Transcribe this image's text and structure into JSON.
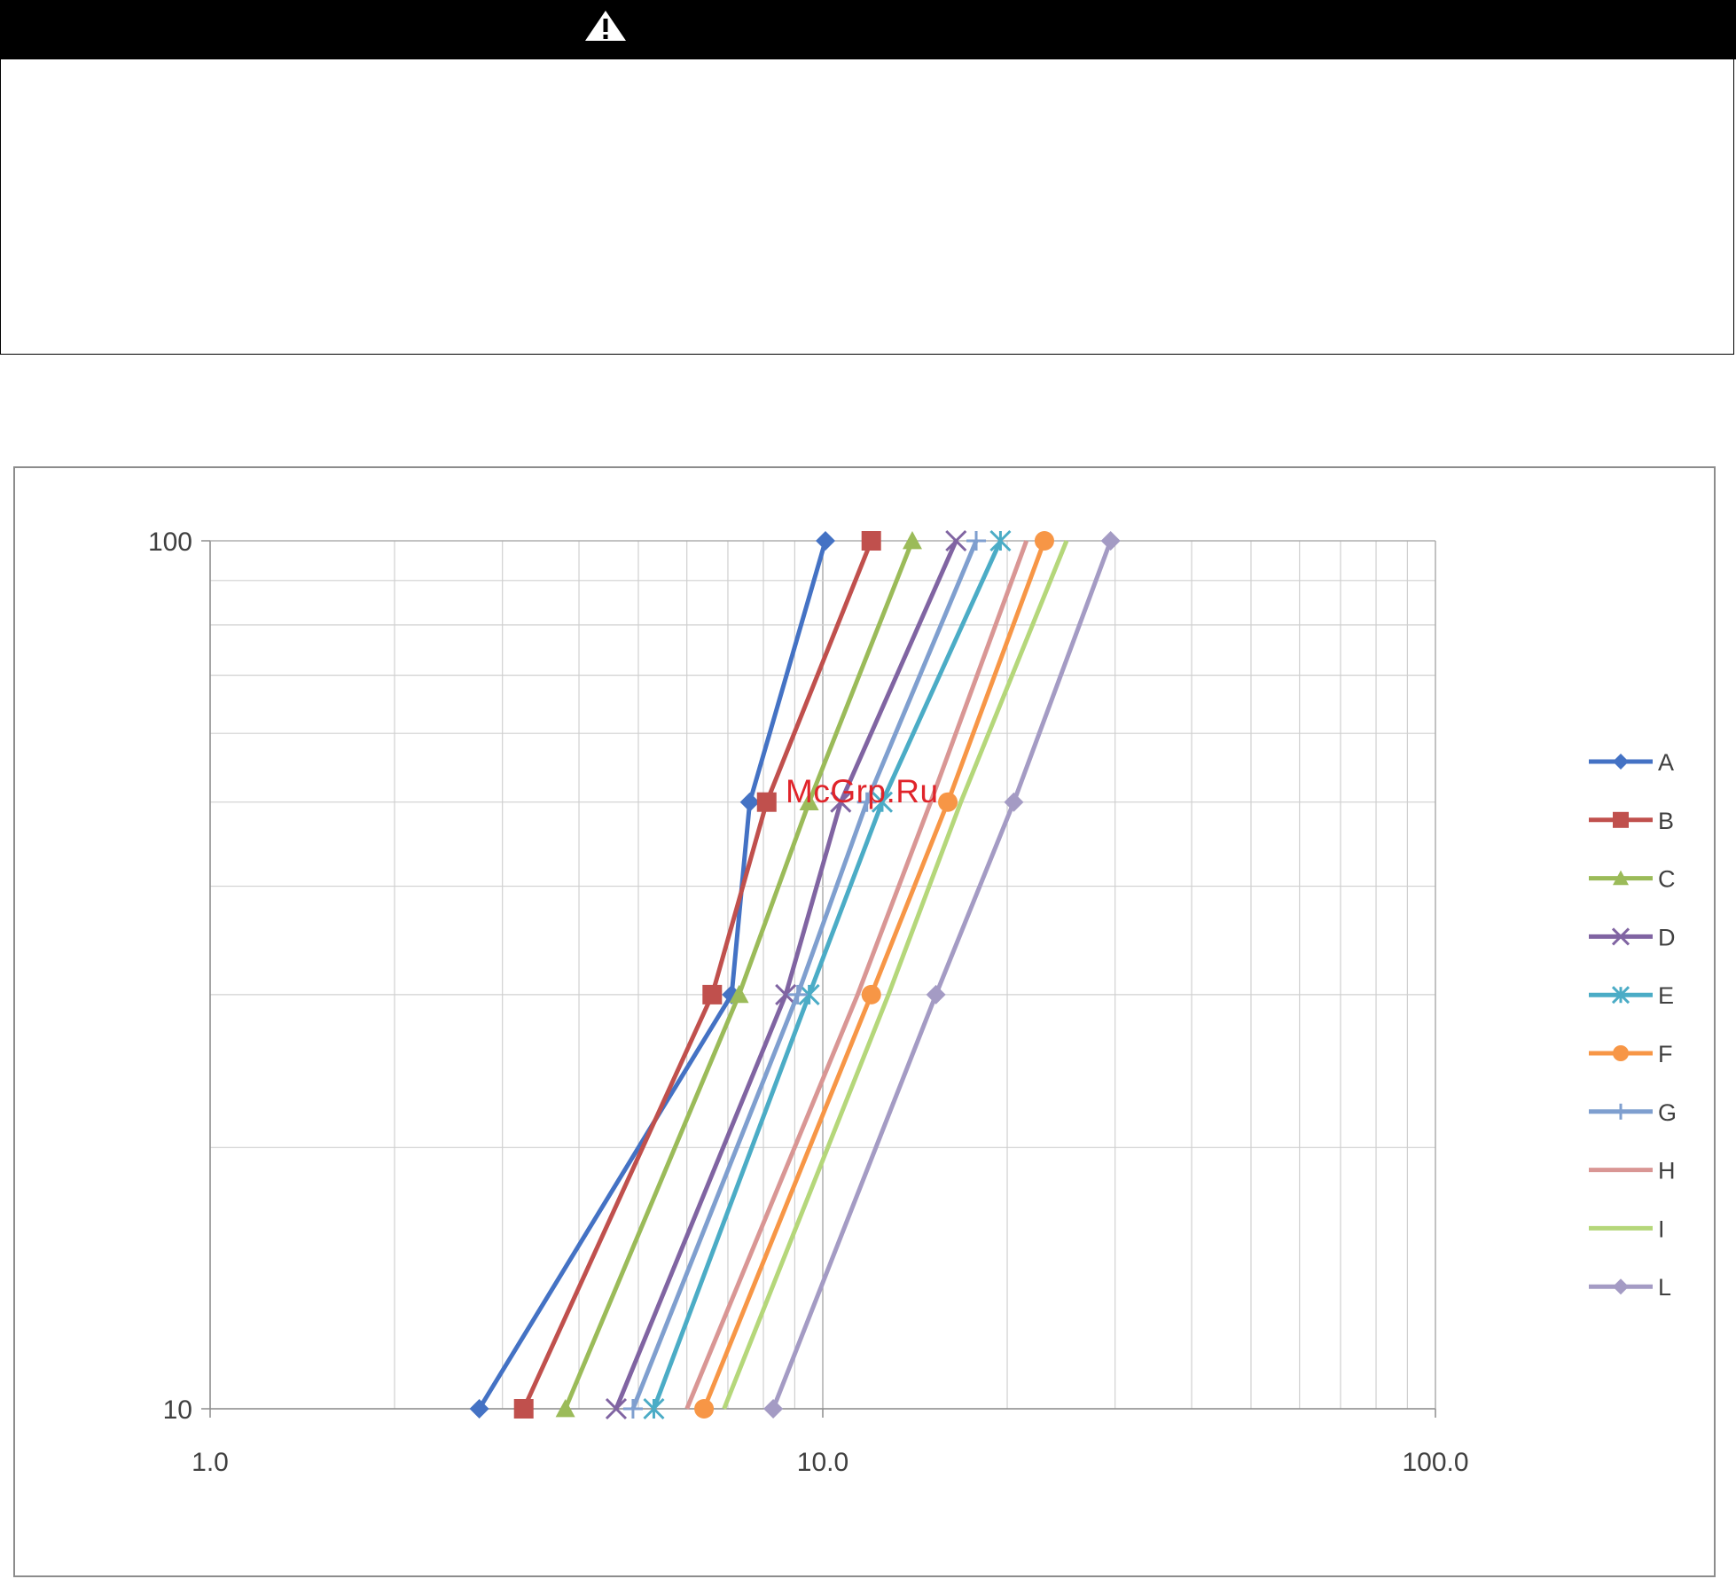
{
  "warning": {
    "icon": "warning-triangle-icon"
  },
  "watermark": "McGrp.Ru",
  "chart_data": {
    "type": "line",
    "title": "",
    "xlabel": "",
    "ylabel": "",
    "x_scale": "log",
    "y_scale": "log",
    "xlim": [
      1,
      100
    ],
    "ylim": [
      10,
      100
    ],
    "x_ticks": [
      "1.0",
      "10.0",
      "100.0"
    ],
    "y_ticks": [
      "10",
      "100"
    ],
    "grid": true,
    "legend": "right",
    "series": [
      {
        "name": "A",
        "color": "#4472c4",
        "marker": "diamond",
        "points": [
          [
            2.75,
            10
          ],
          [
            7.1,
            30
          ],
          [
            7.6,
            50
          ],
          [
            10.1,
            100
          ]
        ]
      },
      {
        "name": "B",
        "color": "#c0504d",
        "marker": "square",
        "points": [
          [
            3.25,
            10
          ],
          [
            6.6,
            30
          ],
          [
            8.1,
            50
          ],
          [
            12.0,
            100
          ]
        ]
      },
      {
        "name": "C",
        "color": "#9bbb59",
        "marker": "triangle",
        "points": [
          [
            3.8,
            10
          ],
          [
            7.3,
            30
          ],
          [
            9.5,
            50
          ],
          [
            14.0,
            100
          ]
        ]
      },
      {
        "name": "D",
        "color": "#8064a2",
        "marker": "x",
        "points": [
          [
            4.6,
            10
          ],
          [
            8.7,
            30
          ],
          [
            10.7,
            50
          ],
          [
            16.5,
            100
          ]
        ]
      },
      {
        "name": "E",
        "color": "#4bacc6",
        "marker": "star",
        "points": [
          [
            5.3,
            10
          ],
          [
            9.5,
            30
          ],
          [
            12.5,
            50
          ],
          [
            19.5,
            100
          ]
        ]
      },
      {
        "name": "F",
        "color": "#f79646",
        "marker": "circle",
        "points": [
          [
            6.4,
            10
          ],
          [
            12.0,
            30
          ],
          [
            16.0,
            50
          ],
          [
            23.0,
            100
          ]
        ]
      },
      {
        "name": "G",
        "color": "#7f9fcf",
        "marker": "plus",
        "points": [
          [
            4.9,
            10
          ],
          [
            9.1,
            30
          ],
          [
            11.8,
            50
          ],
          [
            17.8,
            100
          ]
        ]
      },
      {
        "name": "H",
        "color": "#d99694",
        "marker": "none",
        "points": [
          [
            6.0,
            10
          ],
          [
            11.4,
            30
          ],
          [
            15.0,
            50
          ],
          [
            21.5,
            100
          ]
        ]
      },
      {
        "name": "I",
        "color": "#b5d77a",
        "marker": "none",
        "points": [
          [
            6.9,
            10
          ],
          [
            12.8,
            30
          ],
          [
            16.8,
            50
          ],
          [
            25.0,
            100
          ]
        ]
      },
      {
        "name": "L",
        "color": "#a49bc4",
        "marker": "diamond",
        "points": [
          [
            8.3,
            10
          ],
          [
            15.3,
            30
          ],
          [
            20.5,
            50
          ],
          [
            29.5,
            100
          ]
        ]
      }
    ]
  }
}
